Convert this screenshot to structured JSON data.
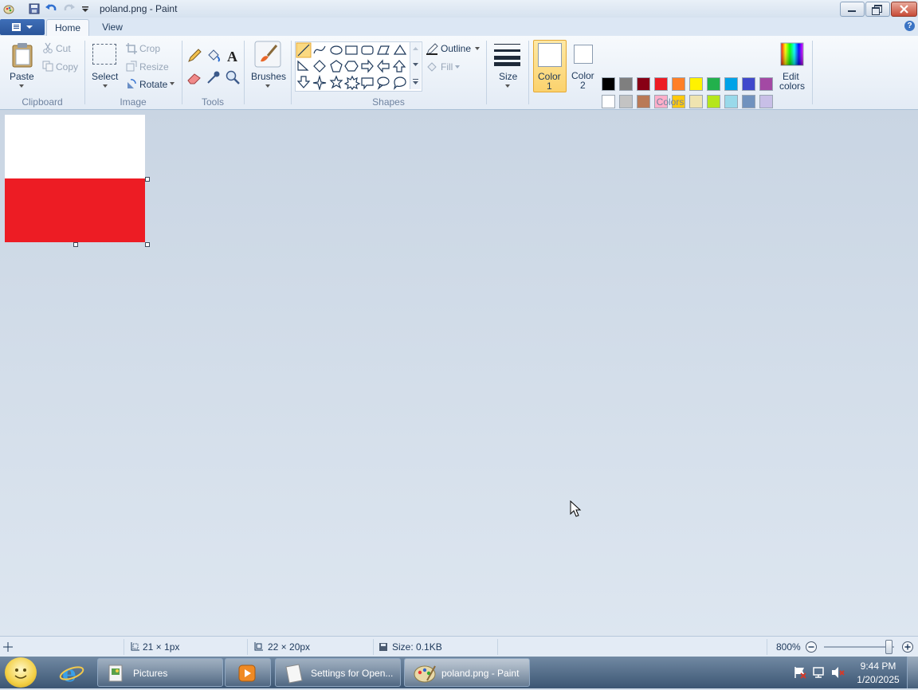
{
  "window": {
    "title": "poland.png - Paint"
  },
  "tabs": [
    {
      "label": "Home",
      "active": true
    },
    {
      "label": "View",
      "active": false
    }
  ],
  "ribbon": {
    "clipboard": {
      "group": "Clipboard",
      "paste": "Paste",
      "cut": "Cut",
      "copy": "Copy"
    },
    "image": {
      "group": "Image",
      "select": "Select",
      "crop": "Crop",
      "resize": "Resize",
      "rotate": "Rotate"
    },
    "tools": {
      "group": "Tools"
    },
    "brushes": {
      "label": "Brushes"
    },
    "shapes": {
      "group": "Shapes",
      "outline": "Outline",
      "fill": "Fill"
    },
    "size": {
      "label": "Size"
    },
    "colors": {
      "group": "Colors",
      "color1": [
        "Color",
        "1"
      ],
      "color2": [
        "Color",
        "2"
      ],
      "edit": [
        "Edit",
        "colors"
      ],
      "color1_value": "#ffffff",
      "color2_value": "#ffffff",
      "palette_row1": [
        "#000000",
        "#7f7f7f",
        "#880015",
        "#ed1c24",
        "#ff7f27",
        "#fff200",
        "#22b14c",
        "#00a2e8",
        "#3f48cc",
        "#a349a4"
      ],
      "palette_row2": [
        "#ffffff",
        "#c3c3c3",
        "#b97a57",
        "#ffaec9",
        "#ffc90e",
        "#efe4b0",
        "#b5e61d",
        "#99d9ea",
        "#7092be",
        "#c8bfe7"
      ]
    }
  },
  "image": {
    "top_color": "#ffffff",
    "bottom_color": "#ed1c24"
  },
  "status": {
    "cursor_pos": "21 × 1px",
    "selection_size": "22 × 20px",
    "file_size": "Size: 0.1KB",
    "zoom": "800%"
  },
  "taskbar": {
    "items": [
      {
        "label": "Pictures"
      },
      {
        "label": ""
      },
      {
        "label": "Settings for Open..."
      },
      {
        "label": "poland.png - Paint",
        "active": true
      }
    ],
    "time": "9:44 PM",
    "date": "1/20/2025"
  }
}
